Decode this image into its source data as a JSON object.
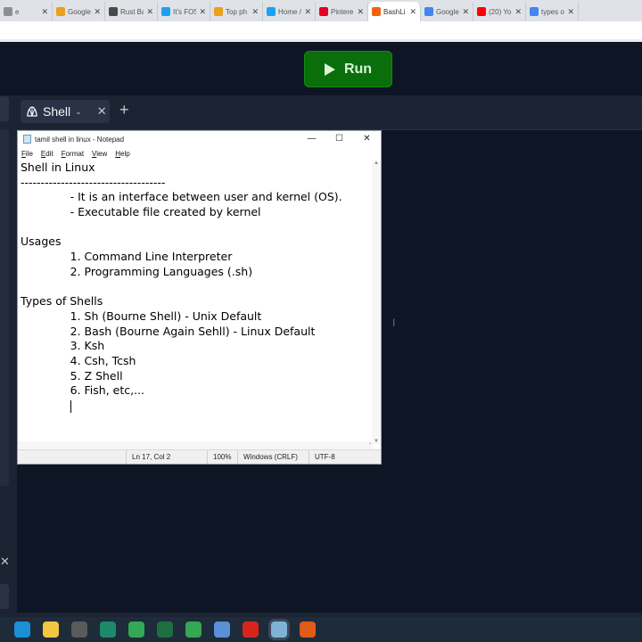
{
  "browser": {
    "tabs": [
      {
        "title": "e",
        "icon": "page-icon",
        "color": "#8a8f99"
      },
      {
        "title": "Google",
        "icon": "g91-icon",
        "color": "#e8a11a"
      },
      {
        "title": "Rust Ba",
        "icon": "rust-icon",
        "color": "#4a4a4a"
      },
      {
        "title": "It's FOS",
        "icon": "twitter-icon",
        "color": "#1da1f2"
      },
      {
        "title": "Top ph",
        "icon": "g91-icon",
        "color": "#e8a11a"
      },
      {
        "title": "Home /",
        "icon": "twitter-icon",
        "color": "#1da1f2"
      },
      {
        "title": "Pintere",
        "icon": "pinterest-icon",
        "color": "#e60023"
      },
      {
        "title": "BashLi",
        "icon": "replit-icon",
        "color": "#f26207",
        "active": true
      },
      {
        "title": "Google",
        "icon": "google-translate-icon",
        "color": "#4285f4"
      },
      {
        "title": "(20) Yo",
        "icon": "youtube-icon",
        "color": "#ff0000"
      },
      {
        "title": "types o",
        "icon": "google-icon",
        "color": "#4285f4"
      }
    ]
  },
  "app": {
    "run_label": "Run",
    "shell_tab_label": "Shell",
    "add_tab_symbol": "+"
  },
  "notepad": {
    "title": "tamil shell in linux - Notepad",
    "menu": [
      "File",
      "Edit",
      "Format",
      "View",
      "Help"
    ],
    "lines": [
      "Shell in Linux",
      "------------------------------------",
      "              - It is an interface between user and kernel (OS).",
      "              - Executable file created by kernel",
      "",
      "Usages",
      "              1. Command Line Interpreter",
      "              2. Programming Languages (.sh)",
      "",
      "Types of Shells",
      "              1. Sh (Bourne Shell) - Unix Default",
      "              2. Bash (Bourne Again Sehll) - Linux Default",
      "              3. Ksh",
      "              4. Csh, Tcsh",
      "              5. Z Shell",
      "              6. Fish, etc,..."
    ],
    "caret_indent": "              ",
    "status": {
      "position": "Ln 17, Col 2",
      "zoom": "100%",
      "line_ending": "Windows (CRLF)",
      "encoding": "UTF-8"
    }
  },
  "taskbar": {
    "icons": [
      {
        "name": "edge-icon",
        "color": "#1b8fd8"
      },
      {
        "name": "file-explorer-icon",
        "color": "#f4c542"
      },
      {
        "name": "calculator-icon",
        "color": "#5a5a5a"
      },
      {
        "name": "app-installer-icon",
        "color": "#1c8a6a"
      },
      {
        "name": "chrome-icon",
        "color": "#34a853"
      },
      {
        "name": "excel-icon",
        "color": "#1d6f42"
      },
      {
        "name": "chrome-profile-icon",
        "color": "#34a853"
      },
      {
        "name": "virtualbox-icon",
        "color": "#5b8fd8"
      },
      {
        "name": "acrobat-icon",
        "color": "#d6261c"
      },
      {
        "name": "notepad-icon",
        "color": "#7fb3d5",
        "active": true
      },
      {
        "name": "media-icon",
        "color": "#e05a1a"
      }
    ]
  }
}
